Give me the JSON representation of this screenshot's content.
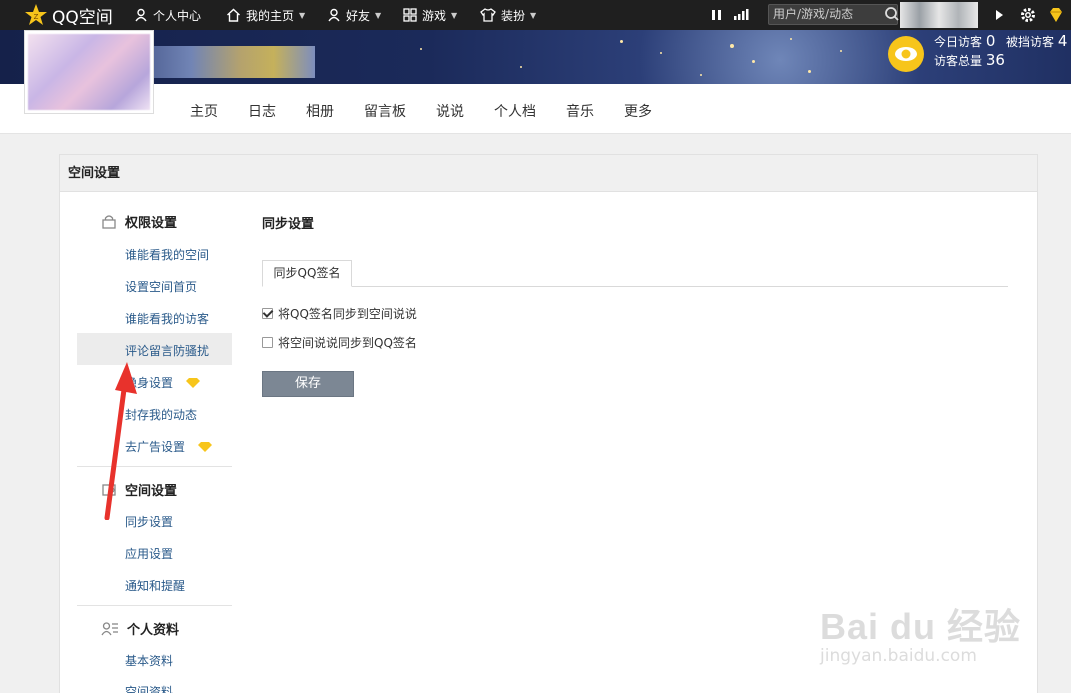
{
  "topbar": {
    "logo_text": "QQ空间",
    "nav": [
      {
        "label": "个人中心",
        "icon": "person-icon"
      },
      {
        "label": "我的主页",
        "icon": "home-icon"
      },
      {
        "label": "好友",
        "icon": "person-icon"
      },
      {
        "label": "游戏",
        "icon": "grid-icon"
      },
      {
        "label": "装扮",
        "icon": "tshirt-icon"
      }
    ],
    "search_placeholder": "用户/游戏/动态",
    "icons": [
      "pause-icon",
      "signal-icon",
      "search-icon",
      "arrow-icon",
      "gear-icon",
      "diamond-icon"
    ],
    "accent": "#f7c51b"
  },
  "banner": {
    "visitors_today_label": "今日访客",
    "visitors_today": "0",
    "blocked_label": "被挡访客",
    "blocked": "4",
    "visitors_total_label": "访客总量",
    "visitors_total": "36"
  },
  "subnav": [
    "主页",
    "日志",
    "相册",
    "留言板",
    "说说",
    "个人档",
    "音乐",
    "更多"
  ],
  "panel": {
    "title": "空间设置",
    "sidebar": {
      "sections": [
        {
          "title": "权限设置",
          "icon": "lock-icon",
          "items": [
            "谁能看我的空间",
            "设置空间首页",
            "谁能看我的访客",
            "评论留言防骚扰",
            "隐身设置",
            "封存我的动态",
            "去广告设置"
          ]
        },
        {
          "title": "空间设置",
          "icon": "settings-icon",
          "items": [
            "同步设置",
            "应用设置",
            "通知和提醒"
          ]
        },
        {
          "title": "个人资料",
          "icon": "profile-icon",
          "items": [
            "基本资料",
            "空间资料"
          ]
        }
      ]
    },
    "content": {
      "title": "同步设置",
      "tab": "同步QQ签名",
      "options": [
        {
          "label": "将QQ签名同步到空间说说",
          "checked": true
        },
        {
          "label": "将空间说说同步到QQ签名",
          "checked": false
        }
      ],
      "save_label": "保存"
    }
  },
  "watermark": {
    "brand": "Bai du 经验",
    "url": "jingyan.baidu.com"
  }
}
